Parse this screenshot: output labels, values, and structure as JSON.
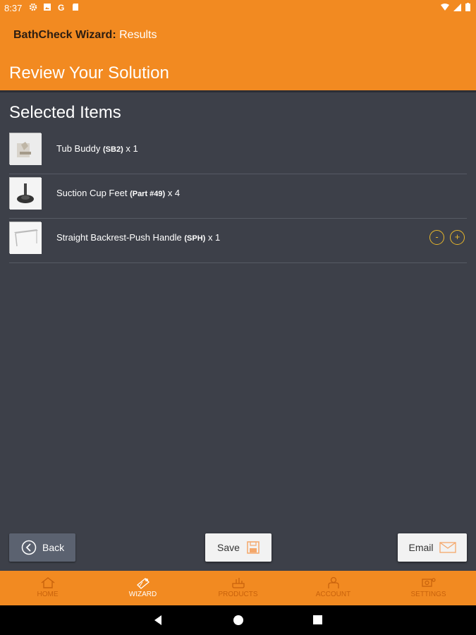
{
  "status_bar": {
    "time": "8:37",
    "icons": [
      "gear-icon",
      "photo-icon",
      "google-icon",
      "sd-card-icon"
    ],
    "right_icons": [
      "wifi-icon",
      "signal-icon",
      "battery-icon"
    ]
  },
  "header": {
    "app_name": "BathCheck Wizard:",
    "app_subtitle": "Results",
    "page_heading": "Review Your Solution"
  },
  "main": {
    "section_title": "Selected Items",
    "items": [
      {
        "name": "Tub Buddy ",
        "code": "(SB2)",
        "qty": " x 1"
      },
      {
        "name": "Suction Cup Feet ",
        "code": "(Part #49)",
        "qty": " x 4"
      },
      {
        "name": "Straight Backrest-Push Handle ",
        "code": "(SPH)",
        "qty": " x 1"
      }
    ],
    "qty_minus": "-",
    "qty_plus": "+"
  },
  "actions": {
    "back_label": "Back",
    "save_label": "Save",
    "email_label": "Email"
  },
  "bottom_nav": {
    "items": [
      {
        "label": "HOME",
        "icon": "home-icon"
      },
      {
        "label": "WIZARD",
        "icon": "wizard-icon"
      },
      {
        "label": "PRODUCTS",
        "icon": "products-icon"
      },
      {
        "label": "ACCOUNT",
        "icon": "account-icon"
      },
      {
        "label": "SETTINGS",
        "icon": "settings-icon"
      }
    ],
    "active": "WIZARD"
  },
  "colors": {
    "accent": "#f28a21",
    "background": "#3d4049",
    "qty_control": "#e8b72b"
  }
}
